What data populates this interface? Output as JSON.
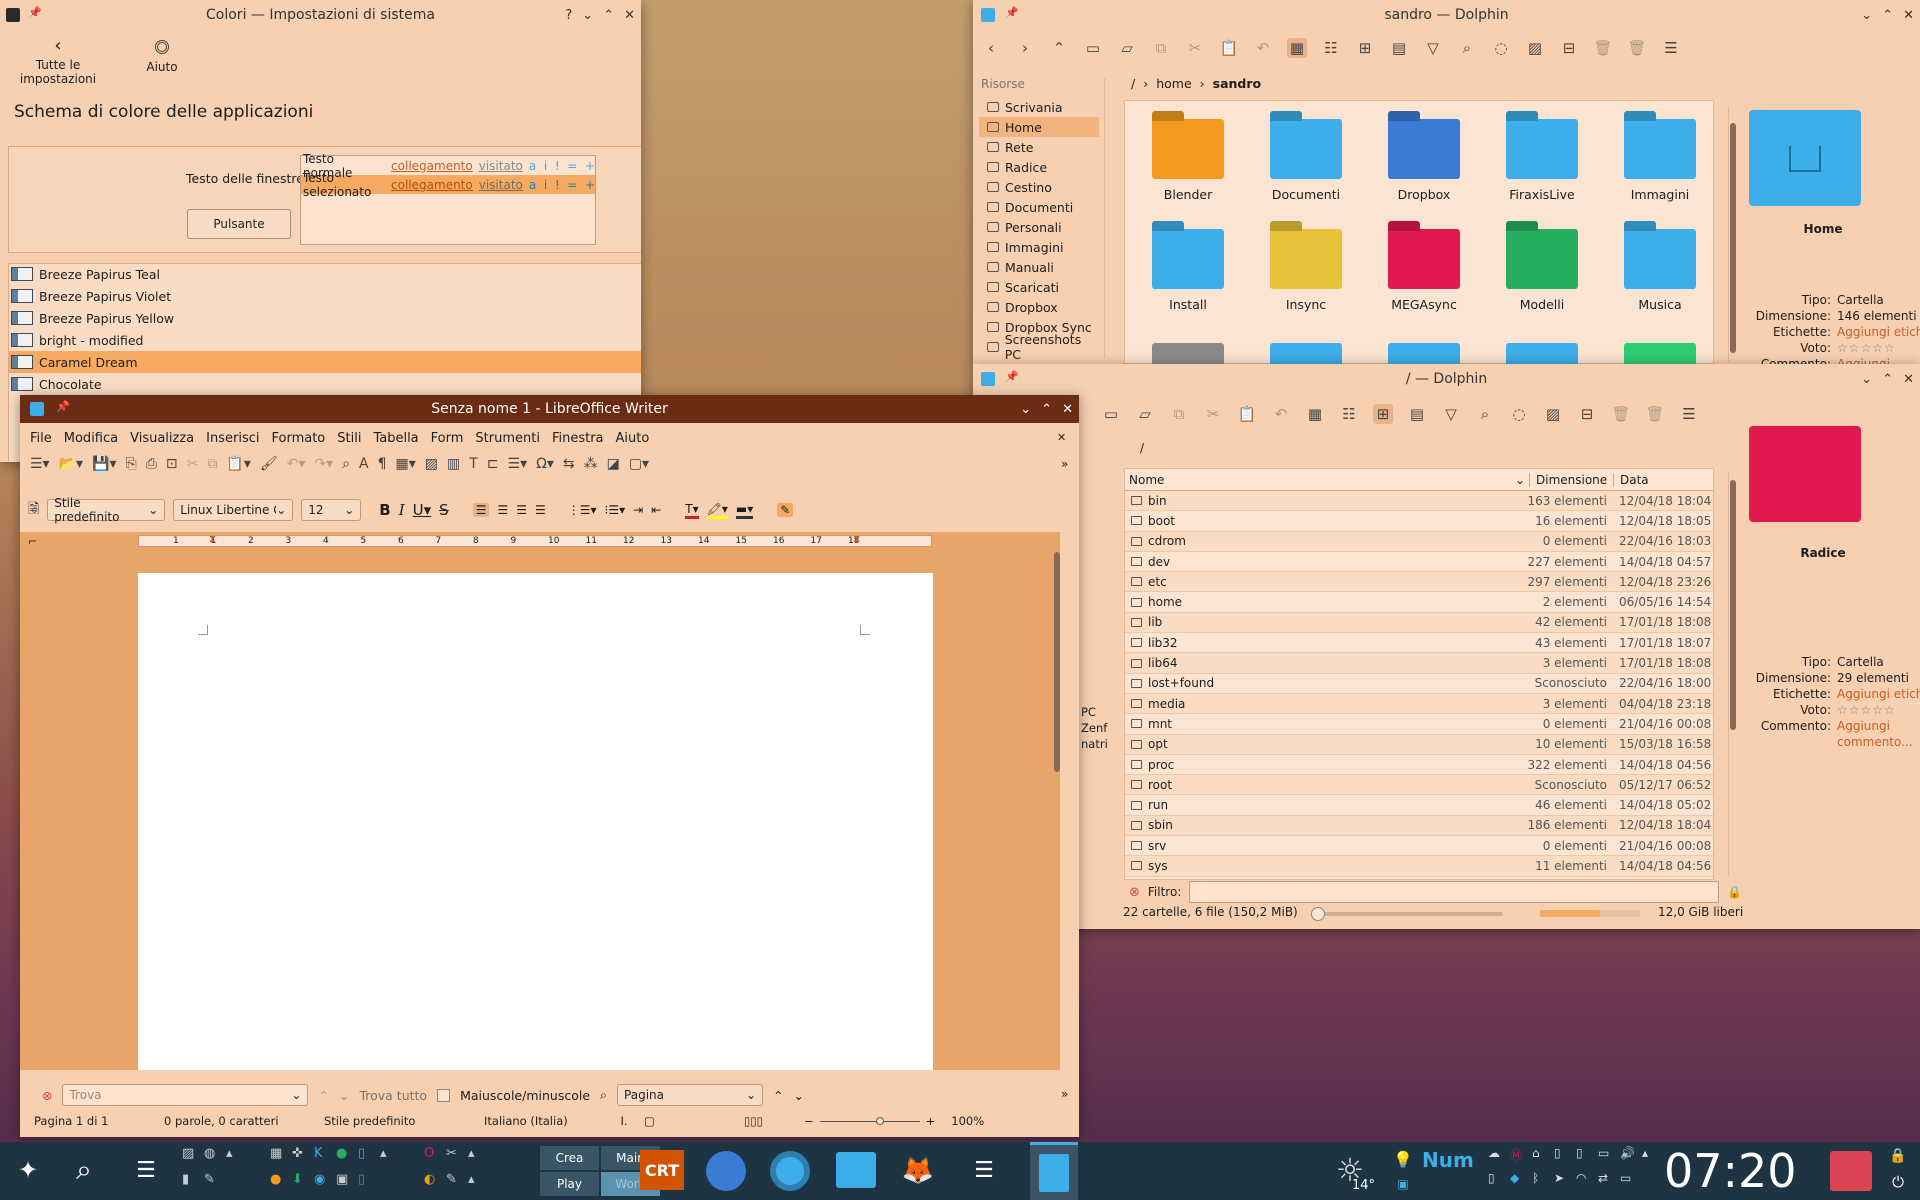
{
  "colors_win": {
    "title": "Colori — Impostazioni di sistema",
    "btn_back": "Tutte le impostazioni",
    "btn_help": "Aiuto",
    "heading": "Schema di colore delle applicazioni",
    "preview_label": "Testo delle finestre",
    "preview_button": "Pulsante",
    "preview_normal": "Testo normale",
    "preview_link": "collegamento",
    "preview_visited": "visitato",
    "preview_sel": "Testo selezionato",
    "preview_marks": "a  i  !  =  +",
    "schemes": [
      "Breeze Papirus Teal",
      "Breeze Papirus Violet",
      "Breeze Papirus Yellow",
      "bright - modified",
      "Caramel Dream",
      "Chocolate"
    ],
    "selected_index": 4
  },
  "dolphin1": {
    "title": "sandro — Dolphin",
    "places_header": "Risorse",
    "places": [
      "Scrivania",
      "Home",
      "Rete",
      "Radice",
      "Cestino",
      "Documenti",
      "Personali",
      "Immagini",
      "Manuali",
      "Scaricati",
      "Dropbox",
      "Dropbox Sync",
      "Screenshots PC"
    ],
    "crumb_root": "/",
    "crumb_home": "home",
    "crumb_user": "sandro",
    "folders": [
      {
        "name": "Blender",
        "color": "#f39a1f"
      },
      {
        "name": "Documenti",
        "color": "#3daee9"
      },
      {
        "name": "Dropbox",
        "color": "#3a7bd5"
      },
      {
        "name": "FiraxisLive",
        "color": "#3daee9"
      },
      {
        "name": "Immagini",
        "color": "#3daee9"
      },
      {
        "name": "Install",
        "color": "#3daee9"
      },
      {
        "name": "Insync",
        "color": "#e8c33a"
      },
      {
        "name": "MEGAsync",
        "color": "#e0194f"
      },
      {
        "name": "Modelli",
        "color": "#27ae60"
      },
      {
        "name": "Musica",
        "color": "#3daee9"
      }
    ],
    "info": {
      "name": "Home",
      "tipo_label": "Tipo:",
      "tipo": "Cartella",
      "dim_label": "Dimensione:",
      "dim": "146 elementi",
      "etich_label": "Etichette:",
      "etich": "Aggiungi etichette",
      "voto_label": "Voto:",
      "voto": "☆☆☆☆☆",
      "comm_label": "Commento:",
      "comm": "Aggiungi"
    }
  },
  "dolphin2": {
    "title": "/ — Dolphin",
    "crumb": "/",
    "cols": {
      "name": "Nome",
      "size": "Dimensione",
      "date": "Data"
    },
    "rows": [
      [
        "bin",
        "163 elementi",
        "12/04/18 18:04"
      ],
      [
        "boot",
        "16 elementi",
        "12/04/18 18:05"
      ],
      [
        "cdrom",
        "0 elementi",
        "22/04/16 18:03"
      ],
      [
        "dev",
        "227 elementi",
        "14/04/18 04:57"
      ],
      [
        "etc",
        "297 elementi",
        "12/04/18 23:26"
      ],
      [
        "home",
        "2 elementi",
        "06/05/16 14:54"
      ],
      [
        "lib",
        "42 elementi",
        "17/01/18 18:08"
      ],
      [
        "lib32",
        "43 elementi",
        "17/01/18 18:07"
      ],
      [
        "lib64",
        "3 elementi",
        "17/01/18 18:08"
      ],
      [
        "lost+found",
        "Sconosciuto",
        "22/04/16 18:00"
      ],
      [
        "media",
        "3 elementi",
        "04/04/18 23:18"
      ],
      [
        "mnt",
        "0 elementi",
        "21/04/16 00:08"
      ],
      [
        "opt",
        "10 elementi",
        "15/03/18 16:58"
      ],
      [
        "proc",
        "322 elementi",
        "14/04/18 04:56"
      ],
      [
        "root",
        "Sconosciuto",
        "05/12/17 06:52"
      ],
      [
        "run",
        "46 elementi",
        "14/04/18 05:02"
      ],
      [
        "sbin",
        "186 elementi",
        "12/04/18 18:04"
      ],
      [
        "srv",
        "0 elementi",
        "21/04/16 00:08"
      ],
      [
        "sys",
        "11 elementi",
        "14/04/18 04:56"
      ]
    ],
    "filter_label": "Filtro:",
    "status": "22 cartelle, 6 file (150,2 MiB)",
    "free": "12,0 GiB liberi",
    "zoom": 0.0,
    "disk_used": 0.6,
    "side_partial": [
      "PC",
      "Zenf",
      "natri"
    ],
    "info": {
      "name": "Radice",
      "tipo_label": "Tipo:",
      "tipo": "Cartella",
      "dim_label": "Dimensione:",
      "dim": "29 elementi",
      "etich_label": "Etichette:",
      "etich": "Aggiungi etichette",
      "voto_label": "Voto:",
      "voto": "☆☆☆☆☆",
      "comm_label": "Commento:",
      "comm": "Aggiungi commento..."
    }
  },
  "writer": {
    "title": "Senza nome 1 - LibreOffice Writer",
    "menu": [
      "File",
      "Modifica",
      "Visualizza",
      "Inserisci",
      "Formato",
      "Stili",
      "Tabella",
      "Form",
      "Strumenti",
      "Finestra",
      "Aiuto"
    ],
    "style": "Stile predefinito",
    "font": "Linux Libertine G",
    "size": "12",
    "ruler": [
      "1",
      "1",
      "2",
      "3",
      "4",
      "5",
      "6",
      "7",
      "8",
      "9",
      "10",
      "11",
      "12",
      "13",
      "14",
      "15",
      "16",
      "17",
      "18"
    ],
    "find_placeholder": "Trova",
    "find_all": "Trova tutto",
    "match_case": "Maiuscole/minuscole",
    "find_scope": "Pagina",
    "status_page": "Pagina 1 di 1",
    "status_words": "0 parole, 0 caratteri",
    "status_style": "Stile predefinito",
    "status_lang": "Italiano (Italia)",
    "status_zoom": "100%"
  },
  "taskbar": {
    "btn_crea": "Crea",
    "btn_main": "Main",
    "btn_play": "Play",
    "btn_work": "Work",
    "crt": "CRT",
    "weather": "14°",
    "num": "Num",
    "clock": "07:20"
  }
}
